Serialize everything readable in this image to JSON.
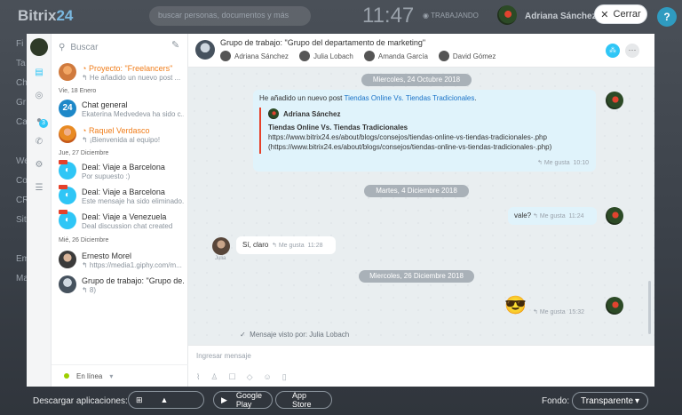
{
  "topbar": {
    "brand": "Bitrix",
    "brand_num": "24",
    "search_placeholder": "buscar personas, documentos y más",
    "clock": "11:47",
    "status": "TRABAJANDO",
    "user_name": "Adriana Sánchez",
    "close_label": "Cerrar",
    "help_icon": "question-icon"
  },
  "leftmenu": [
    "Fi",
    "Ta",
    "Ch",
    "Gr",
    "Ca",
    "We",
    "Co",
    "CR",
    "Sit",
    "Em",
    "Ma"
  ],
  "rail": {
    "badge": "3"
  },
  "list": {
    "search_placeholder": "Buscar",
    "items": [
      {
        "title": "Proyecto: \"Freelancers\"",
        "sub": "↰ He añadido un nuevo post ...",
        "orange": true
      },
      {
        "date": "Vie, 18 Enero"
      },
      {
        "title": "Chat general",
        "sub": "Ekaterina Medvedeva ha sido c..."
      },
      {
        "title": "Raquel Verdasco",
        "sub": "↰ ¡Bienvenida al equipo!",
        "orange": true
      },
      {
        "date": "Jue, 27 Diciembre"
      },
      {
        "title": "Deal: Viaje a Barcelona",
        "sub": "Por supuesto :)"
      },
      {
        "title": "Deal: Viaje a Barcelona",
        "sub": "Este mensaje ha sido eliminado."
      },
      {
        "title": "Deal: Viaje a Venezuela",
        "sub": "Deal discussion chat created"
      },
      {
        "date": "Mié, 26 Diciembre"
      },
      {
        "title": "Ernesto Morel",
        "sub": "↰ https://media1.giphy.com/m..."
      },
      {
        "title": "Grupo de trabajo: \"Grupo de...",
        "sub": "↰ 8)"
      }
    ],
    "status": "En línea"
  },
  "chat": {
    "title": "Grupo de trabajo: \"Grupo del departamento de marketing\"",
    "members": [
      "Adriana Sánchez",
      "Julia Lobach",
      "Amanda García",
      "David Gómez"
    ],
    "date1": "Miercoles, 24 Octubre 2018",
    "msg1_prefix": "He añadido un nuevo post ",
    "msg1_link": "Tiendas Online Vs. Tiendas Tradicionales",
    "msg1_suffix": ".",
    "quote_author": "Adriana Sánchez",
    "quote_title": "Tiendas Online Vs. Tiendas Tradicionales",
    "quote_url1": "https://www.bitrix24.es/about/blogs/consejos/tiendas-online-vs-tiendas-tradicionales-.php",
    "quote_url2": "(https://www.bitrix24.es/about/blogs/consejos/tiendas-online-vs-tiendas-tradicionales-.php)",
    "msg1_like": "Me gusta",
    "msg1_time": "10:10",
    "date2": "Martes, 4 Diciembre 2018",
    "msg2": "vale?",
    "msg2_like": "Me gusta",
    "msg2_time": "11:24",
    "msg3": "Sí, claro",
    "msg3_like": "Me gusta",
    "msg3_time": "11:28",
    "msg3_author": "Julia",
    "date3": "Miercoles, 26 Diciembre 2018",
    "msg4_emoji": "😎",
    "msg4_like": "Me gusta",
    "msg4_time": "15:32",
    "seen": "Mensaje visto por: Julia Lobach",
    "input_placeholder": "Ingresar mensaje"
  },
  "bottom": {
    "download_label": "Descargar aplicaciones:",
    "google_play": "Google Play",
    "app_store": "App Store",
    "fondo_label": "Fondo:",
    "fondo_value": "Transparente"
  }
}
